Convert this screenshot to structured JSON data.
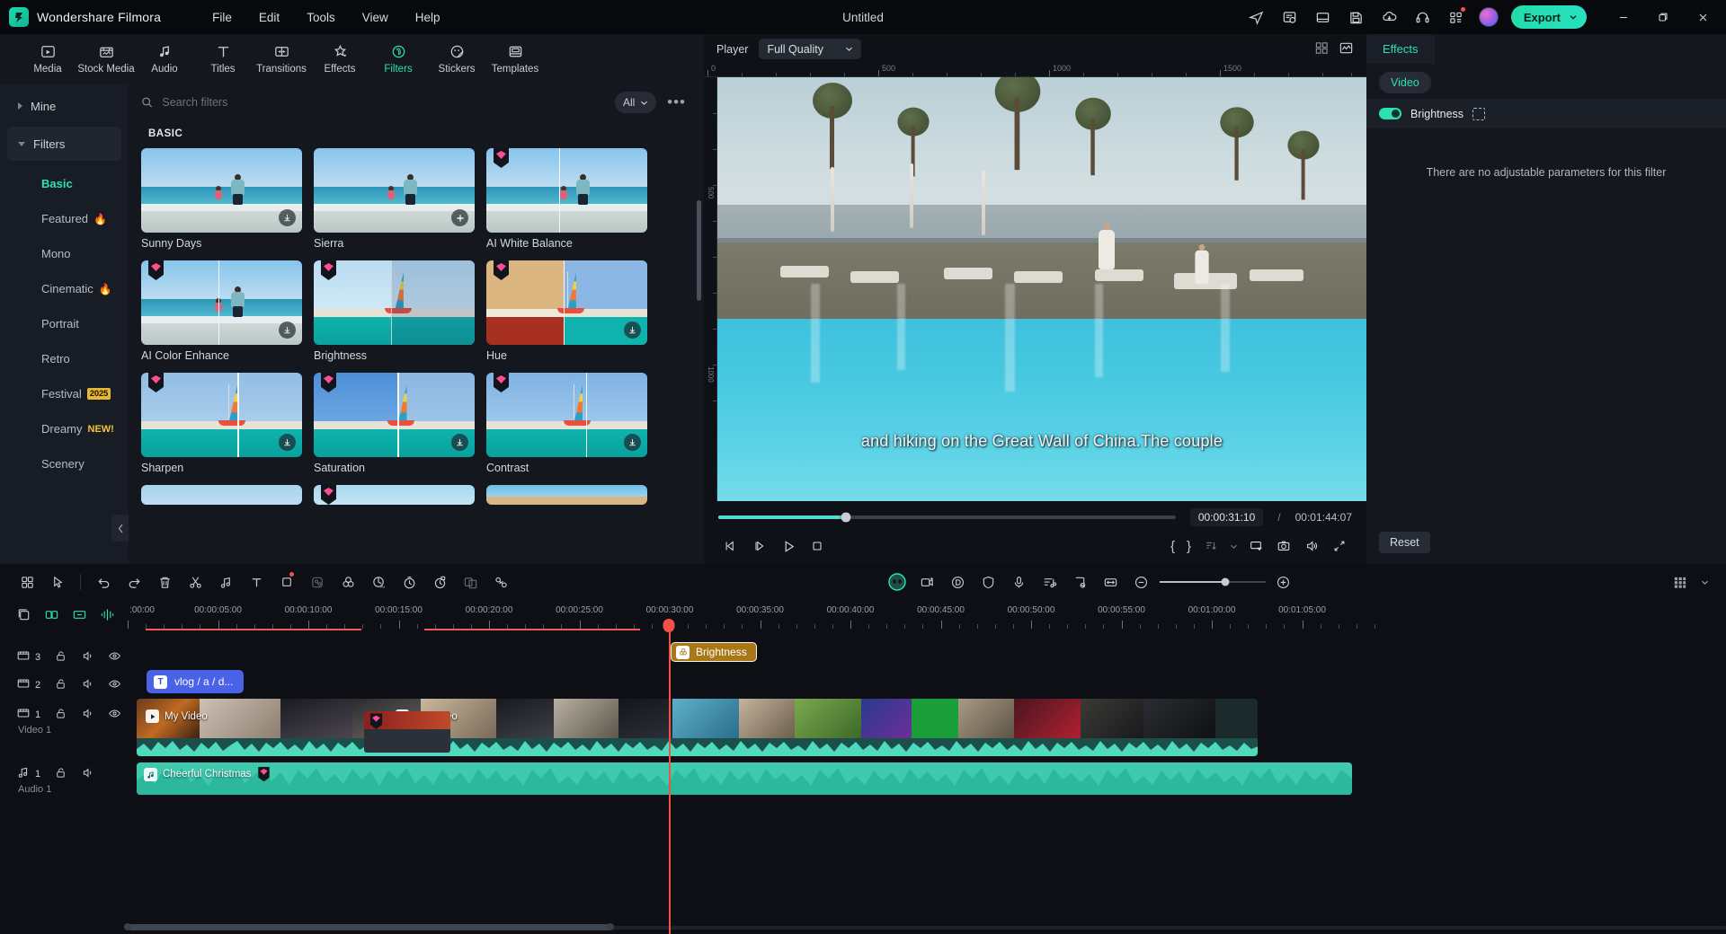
{
  "titlebar": {
    "brand": "Wondershare Filmora",
    "menus": [
      "File",
      "Edit",
      "Tools",
      "View",
      "Help"
    ],
    "window_title": "Untitled",
    "icons": [
      "share-icon",
      "project-notes-icon",
      "layout-icon",
      "save-icon",
      "cloud-download-icon",
      "headset-support-icon",
      "apps-grid-icon"
    ],
    "export_label": "Export",
    "window_controls": [
      "minimize",
      "maximize",
      "close"
    ]
  },
  "tabs": [
    {
      "label": "Media",
      "icon": "media-icon",
      "active": false
    },
    {
      "label": "Stock Media",
      "icon": "stock-media-icon",
      "active": false
    },
    {
      "label": "Audio",
      "icon": "audio-icon",
      "active": false
    },
    {
      "label": "Titles",
      "icon": "titles-icon",
      "active": false
    },
    {
      "label": "Transitions",
      "icon": "transitions-icon",
      "active": false
    },
    {
      "label": "Effects",
      "icon": "effects-icon",
      "active": false
    },
    {
      "label": "Filters",
      "icon": "filters-icon",
      "active": true
    },
    {
      "label": "Stickers",
      "icon": "stickers-icon",
      "active": false
    },
    {
      "label": "Templates",
      "icon": "templates-icon",
      "active": false
    }
  ],
  "categories": {
    "roots": [
      {
        "label": "Mine",
        "expanded": false
      },
      {
        "label": "Filters",
        "expanded": true
      }
    ],
    "items": [
      {
        "label": "Basic",
        "active": true,
        "badge": ""
      },
      {
        "label": "Featured",
        "active": false,
        "badge": "flame"
      },
      {
        "label": "Mono",
        "active": false,
        "badge": ""
      },
      {
        "label": "Cinematic",
        "active": false,
        "badge": "flame"
      },
      {
        "label": "Portrait",
        "active": false,
        "badge": ""
      },
      {
        "label": "Retro",
        "active": false,
        "badge": ""
      },
      {
        "label": "Festival",
        "active": false,
        "badge": "2025"
      },
      {
        "label": "Dreamy",
        "active": false,
        "badge": "NEW!"
      },
      {
        "label": "Scenery",
        "active": false,
        "badge": ""
      }
    ]
  },
  "browse": {
    "search_placeholder": "Search filters",
    "search_value": "",
    "filter_dropdown": "All",
    "section_title": "BASIC",
    "filters": [
      {
        "name": "Sunny Days",
        "art": "beach",
        "gem": false,
        "download": true,
        "selected": false
      },
      {
        "name": "Sierra",
        "art": "beach",
        "gem": false,
        "download": false,
        "plus": true,
        "selected": false
      },
      {
        "name": "AI White Balance",
        "art": "beach-split",
        "gem": true,
        "download": false,
        "selected": false
      },
      {
        "name": "AI Color Enhance",
        "art": "beach-split",
        "gem": true,
        "download": true,
        "selected": false
      },
      {
        "name": "Brightness",
        "art": "boat-split",
        "gem": true,
        "download": false,
        "selected": true
      },
      {
        "name": "Hue",
        "art": "boat-hue",
        "gem": true,
        "download": true,
        "selected": false
      },
      {
        "name": "Sharpen",
        "art": "boat-split",
        "gem": true,
        "download": true,
        "selected": false
      },
      {
        "name": "Saturation",
        "art": "boat-sat",
        "gem": true,
        "download": true,
        "selected": false
      },
      {
        "name": "Contrast",
        "art": "boat-split",
        "gem": true,
        "download": true,
        "selected": false
      }
    ]
  },
  "player": {
    "label": "Player",
    "quality": "Full Quality",
    "hruler_labels": [
      "0",
      "500",
      "1000",
      "1500"
    ],
    "vruler_labels": [
      "500",
      "1000"
    ],
    "subtitle": "and hiking on the Great Wall of China.The couple",
    "current_time": "00:00:31:10",
    "total_time": "00:01:44:07",
    "separator": "/",
    "progress_percent": 28,
    "controls": [
      "prev-frame-icon",
      "next-frame-icon",
      "play-icon",
      "stop-icon"
    ],
    "right_controls": [
      "mark-in-brace",
      "mark-out-brace",
      "sort-icon",
      "chevron-down-icon",
      "pop-out-icon",
      "snapshot-icon",
      "volume-icon",
      "fullscreen-icon"
    ],
    "brace_in": "{",
    "brace_out": "}"
  },
  "effects_panel": {
    "tab": "Effects",
    "chip": "Video",
    "item_name": "Brightness",
    "item_enabled": true,
    "empty_message": "There are no adjustable parameters for this filter",
    "reset_label": "Reset"
  },
  "timeline": {
    "toolbar_left": [
      "grid-view-icon",
      "cursor-select-icon",
      "undo-icon",
      "redo-icon",
      "delete-icon",
      "split-scissors-icon",
      "audio-detach-icon",
      "text-icon",
      "crop-icon",
      "color-match-icon",
      "color-wheel-icon",
      "ai-audio-icon",
      "speed-icon",
      "stabilize-icon",
      "green-screen-icon",
      "link-icon"
    ],
    "toolbar_center": [
      "ai-avatar-icon",
      "ai-video-icon",
      "record-icon",
      "shield-icon",
      "microphone-icon",
      "audio-mixer-icon",
      "marker-icon",
      "fit-timeline-icon"
    ],
    "zoom_out": "minus-icon",
    "zoom_in": "plus-icon",
    "zoom_percent": 62,
    "toolbar_right": [
      "grid-dots-icon",
      "chevron-down-icon"
    ],
    "head_icons": [
      "add-media-icon",
      "add-track-icon",
      "render-preview-icon",
      "auto-beat-icon"
    ],
    "ruler_labels": [
      ":00:00",
      "00:00:05:00",
      "00:00:10:00",
      "00:00:15:00",
      "00:00:20:00",
      "00:00:25:00",
      "00:00:30:00",
      "00:00:35:00",
      "00:00:40:00",
      "00:00:45:00",
      "00:00:50:00",
      "00:00:55:00",
      "00:01:00:00",
      "00:01:05:00"
    ],
    "tracks": [
      {
        "type": "video",
        "number": "3",
        "name": "",
        "icons": [
          "film-icon",
          "unlock-icon",
          "speaker-icon",
          "eye-icon"
        ]
      },
      {
        "type": "video",
        "number": "2",
        "name": "",
        "icons": [
          "film-icon",
          "unlock-icon",
          "speaker-icon",
          "eye-icon"
        ]
      },
      {
        "type": "video",
        "number": "1",
        "name": "Video 1",
        "icons": [
          "film-icon",
          "unlock-icon",
          "speaker-icon",
          "eye-icon"
        ]
      },
      {
        "type": "audio",
        "number": "1",
        "name": "Audio 1",
        "icons": [
          "music-icon",
          "unlock-icon",
          "speaker-icon"
        ]
      }
    ],
    "clips": {
      "title_clip": "vlog / a / d...",
      "video_clip_1": "My Video",
      "video_clip_2": "My Video",
      "audio_clip": "Cheerful Christmas",
      "effect_clip": "Brightness"
    }
  },
  "colors": {
    "accent": "#2fe0b0",
    "export_gradient_start": "#23dca9",
    "playhead": "#f0524a",
    "title_clip": "#4a62e8",
    "audio_clip": "#3fc9ae",
    "effect_clip": "#a87816",
    "gem": "#ff4d91"
  }
}
